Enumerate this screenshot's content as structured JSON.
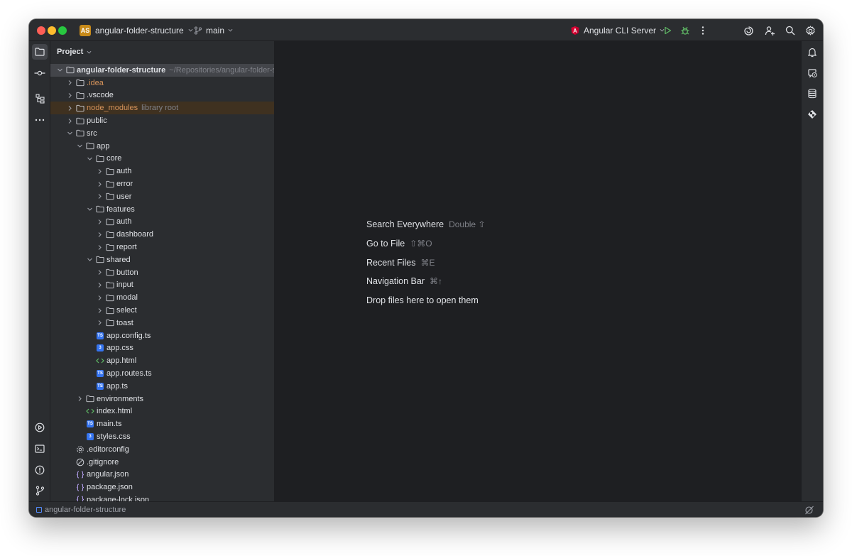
{
  "titlebar": {
    "project_badge": "AS",
    "project_name": "angular-folder-structure",
    "branch": "main",
    "run_config": "Angular CLI Server"
  },
  "project_panel": {
    "title": "Project",
    "tree": [
      {
        "name": "angular-folder-structure",
        "hint": "~/Repositories/angular-folder-structure",
        "depth": 0,
        "kind": "folder",
        "arrow": "open",
        "bold": true,
        "selected": true
      },
      {
        "name": ".idea",
        "depth": 1,
        "kind": "folder",
        "arrow": "closed",
        "orange": true
      },
      {
        "name": ".vscode",
        "depth": 1,
        "kind": "folder",
        "arrow": "closed"
      },
      {
        "name": "node_modules",
        "hint": "library root",
        "depth": 1,
        "kind": "folder",
        "arrow": "closed",
        "orange": true,
        "library": true
      },
      {
        "name": "public",
        "depth": 1,
        "kind": "folder",
        "arrow": "closed"
      },
      {
        "name": "src",
        "depth": 1,
        "kind": "folder",
        "arrow": "open"
      },
      {
        "name": "app",
        "depth": 2,
        "kind": "folder",
        "arrow": "open"
      },
      {
        "name": "core",
        "depth": 3,
        "kind": "folder",
        "arrow": "open"
      },
      {
        "name": "auth",
        "depth": 4,
        "kind": "folder",
        "arrow": "closed"
      },
      {
        "name": "error",
        "depth": 4,
        "kind": "folder",
        "arrow": "closed"
      },
      {
        "name": "user",
        "depth": 4,
        "kind": "folder",
        "arrow": "closed"
      },
      {
        "name": "features",
        "depth": 3,
        "kind": "folder",
        "arrow": "open"
      },
      {
        "name": "auth",
        "depth": 4,
        "kind": "folder",
        "arrow": "closed"
      },
      {
        "name": "dashboard",
        "depth": 4,
        "kind": "folder",
        "arrow": "closed"
      },
      {
        "name": "report",
        "depth": 4,
        "kind": "folder",
        "arrow": "closed"
      },
      {
        "name": "shared",
        "depth": 3,
        "kind": "folder",
        "arrow": "open"
      },
      {
        "name": "button",
        "depth": 4,
        "kind": "folder",
        "arrow": "closed"
      },
      {
        "name": "input",
        "depth": 4,
        "kind": "folder",
        "arrow": "closed"
      },
      {
        "name": "modal",
        "depth": 4,
        "kind": "folder",
        "arrow": "closed"
      },
      {
        "name": "select",
        "depth": 4,
        "kind": "folder",
        "arrow": "closed"
      },
      {
        "name": "toast",
        "depth": 4,
        "kind": "folder",
        "arrow": "closed"
      },
      {
        "name": "app.config.ts",
        "depth": 3,
        "kind": "ts"
      },
      {
        "name": "app.css",
        "depth": 3,
        "kind": "css"
      },
      {
        "name": "app.html",
        "depth": 3,
        "kind": "html"
      },
      {
        "name": "app.routes.ts",
        "depth": 3,
        "kind": "ts"
      },
      {
        "name": "app.ts",
        "depth": 3,
        "kind": "ts"
      },
      {
        "name": "environments",
        "depth": 2,
        "kind": "folder",
        "arrow": "closed"
      },
      {
        "name": "index.html",
        "depth": 2,
        "kind": "html"
      },
      {
        "name": "main.ts",
        "depth": 2,
        "kind": "ts"
      },
      {
        "name": "styles.css",
        "depth": 2,
        "kind": "css"
      },
      {
        "name": ".editorconfig",
        "depth": 1,
        "kind": "gear"
      },
      {
        "name": ".gitignore",
        "depth": 1,
        "kind": "ignore"
      },
      {
        "name": "angular.json",
        "depth": 1,
        "kind": "json"
      },
      {
        "name": "package.json",
        "depth": 1,
        "kind": "json"
      },
      {
        "name": "package-lock.json",
        "depth": 1,
        "kind": "json"
      }
    ]
  },
  "editor": {
    "hints": [
      {
        "label": "Search Everywhere",
        "shortcut": "Double ⇧"
      },
      {
        "label": "Go to File",
        "shortcut": "⇧⌘O"
      },
      {
        "label": "Recent Files",
        "shortcut": "⌘E"
      },
      {
        "label": "Navigation Bar",
        "shortcut": "⌘↑"
      },
      {
        "label": "Drop files here to open them",
        "shortcut": ""
      }
    ]
  },
  "statusbar": {
    "breadcrumb": "angular-folder-structure"
  },
  "colors": {
    "background": "#1e1f22",
    "panel": "#2b2d30",
    "text": "#dfe1e5",
    "muted": "#7f8188",
    "accent": "#548af7",
    "excluded": "#d6935a",
    "run_green": "#5fb865"
  }
}
